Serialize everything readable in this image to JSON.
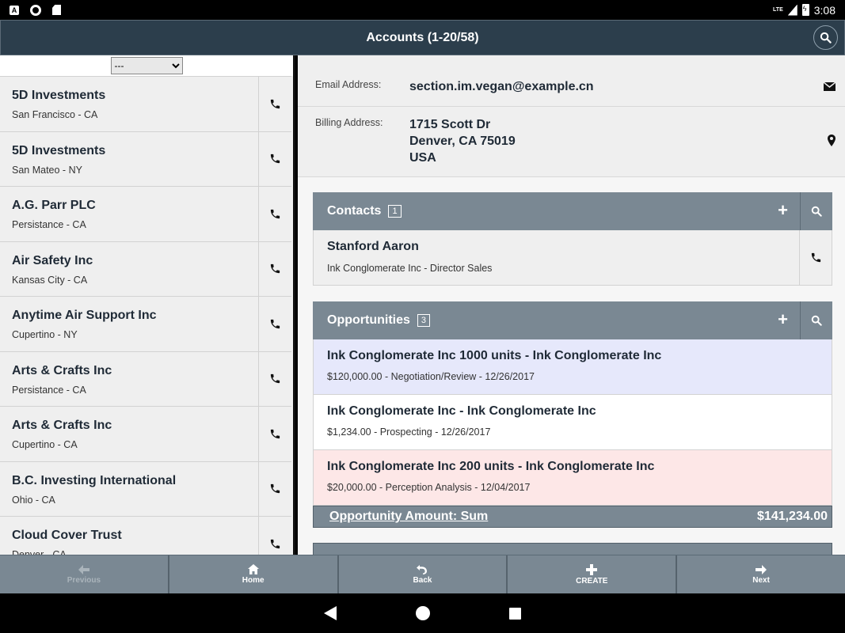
{
  "status": {
    "time": "3:08",
    "network": "LTE"
  },
  "header": {
    "title": "Accounts (1-20/58)"
  },
  "filter": {
    "selected": "---"
  },
  "accounts": [
    {
      "name": "5D Investments",
      "location": "San Francisco - CA"
    },
    {
      "name": "5D Investments",
      "location": "San Mateo - NY"
    },
    {
      "name": "A.G. Parr PLC",
      "location": "Persistance - CA"
    },
    {
      "name": "Air Safety Inc",
      "location": "Kansas City - CA"
    },
    {
      "name": "Anytime Air Support Inc",
      "location": "Cupertino - NY"
    },
    {
      "name": "Arts & Crafts Inc",
      "location": "Persistance - CA"
    },
    {
      "name": "Arts & Crafts Inc",
      "location": "Cupertino - CA"
    },
    {
      "name": "B.C. Investing International",
      "location": "Ohio - CA"
    },
    {
      "name": "Cloud Cover Trust",
      "location": "Denver - CA"
    }
  ],
  "detail": {
    "email_label": "Email Address:",
    "email_value": "section.im.vegan@example.cn",
    "billing_label": "Billing Address:",
    "billing_line1": "1715 Scott Dr",
    "billing_line2": "Denver, CA 75019",
    "billing_line3": "USA"
  },
  "contacts": {
    "title": "Contacts",
    "count": "1",
    "items": [
      {
        "name": "Stanford Aaron",
        "sub": "Ink Conglomerate Inc - Director Sales"
      }
    ]
  },
  "opportunities": {
    "title": "Opportunities",
    "count": "3",
    "items": [
      {
        "title": "Ink Conglomerate Inc 1000 units - Ink Conglomerate Inc",
        "sub": "$120,000.00 - Negotiation/Review - 12/26/2017",
        "color": "#e6e8fb"
      },
      {
        "title": "Ink Conglomerate Inc - Ink Conglomerate Inc",
        "sub": "$1,234.00 - Prospecting - 12/26/2017",
        "color": "#ffffff"
      },
      {
        "title": "Ink Conglomerate Inc 200 units - Ink Conglomerate Inc",
        "sub": "$20,000.00 - Perception Analysis - 12/04/2017",
        "color": "#fde7e7"
      }
    ],
    "sum_label": "Opportunity Amount: Sum",
    "sum_value": "$141,234.00"
  },
  "toolbar": {
    "previous": "Previous",
    "home": "Home",
    "back": "Back",
    "create": "CREATE",
    "next": "Next"
  },
  "icons": {
    "phone": "phone-icon",
    "mail": "mail-icon",
    "pin": "map-pin-icon",
    "search": "search-icon",
    "plus": "plus-icon"
  },
  "colors": {
    "header_bg": "#2c3e4c",
    "section_bg": "#7a8893",
    "toolbar_bg": "#7a8893"
  }
}
